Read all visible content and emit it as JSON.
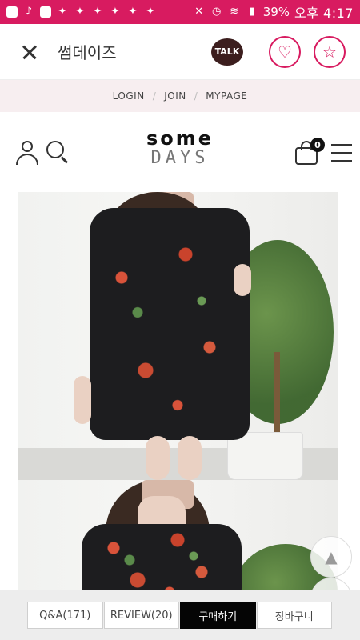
{
  "status_bar": {
    "battery": "39%",
    "time": "오후 4:17",
    "icons": [
      "message-icon",
      "app-icon",
      "image-icon",
      "twitter-icon",
      "twitter-icon",
      "twitter-icon",
      "twitter-icon",
      "twitter-icon",
      "twitter-icon",
      "mute-icon",
      "alarm-icon",
      "wifi-icon",
      "signal-icon"
    ]
  },
  "appbar": {
    "title": "썸데이즈",
    "talk_label": "TALK",
    "heart_glyph": "♡",
    "star_glyph": "☆"
  },
  "top_links": {
    "login": "LOGIN",
    "join": "JOIN",
    "mypage": "MYPAGE",
    "separator": "/"
  },
  "shop": {
    "logo_line1": "some",
    "logo_line2": "DAYS",
    "cart_count": "0"
  },
  "scroll": {
    "up": "▲",
    "down": "▼"
  },
  "bottom_bar": {
    "qa": "Q&A(171)",
    "review": "REVIEW(20)",
    "buy": "구매하기",
    "cart": "장바구니"
  },
  "colors": {
    "brand_pink": "#d81b60",
    "talk_brown": "#3c1e1e",
    "buy_black": "#050505"
  }
}
